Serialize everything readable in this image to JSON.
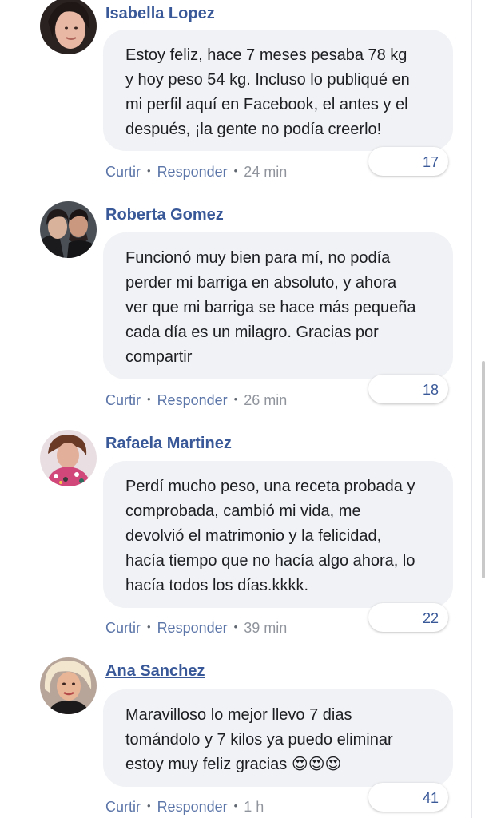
{
  "comments": [
    {
      "author": "Isabella Lopez",
      "text": "Estoy feliz, hace 7 meses pesaba 78 kg\ny hoy peso 54 kg. Incluso lo publiqué en\nmi perfil aquí en Facebook, el antes y el\ndespués, ¡la gente no podía creerlo!",
      "reactions": "17",
      "like_label": "Curtir",
      "reply_label": "Responder",
      "time": "24 min"
    },
    {
      "author": "Roberta Gomez",
      "text": "Funcionó muy bien para mí, no podía\nperder mi barriga en absoluto, y ahora\nver que mi barriga se hace más pequeña\ncada día es un milagro. Gracias por\ncompartir",
      "reactions": "18",
      "like_label": "Curtir",
      "reply_label": "Responder",
      "time": "26 min"
    },
    {
      "author": "Rafaela Martinez",
      "text": "Perdí mucho peso, una receta probada y\ncomprobada, cambió mi vida, me\ndevolvió el matrimonio y la felicidad,\nhacía tiempo que no hacía algo ahora, lo\nhacía todos los días.kkkk.",
      "reactions": "22",
      "like_label": "Curtir",
      "reply_label": "Responder",
      "time": "39 min"
    },
    {
      "author": "Ana Sanchez",
      "text": "Maravilloso lo mejor llevo 7 dias\ntomándolo y 7 kilos ya puedo eliminar\nestoy muy feliz gracias 😍😍😍",
      "reactions": "41",
      "like_label": "Curtir",
      "reply_label": "Responder",
      "time": "1 h"
    }
  ],
  "colors": {
    "author_link": "#385898",
    "action_link": "#5b75a8",
    "bubble_bg": "#f0f2f5",
    "text": "#1c1e21",
    "timestamp": "#90949c"
  }
}
